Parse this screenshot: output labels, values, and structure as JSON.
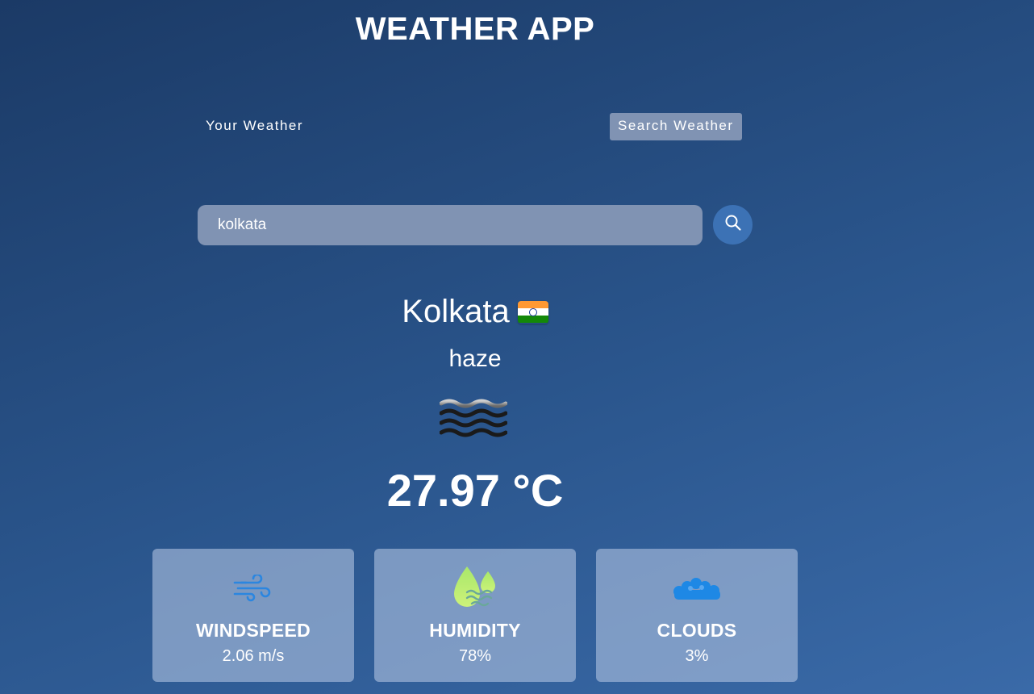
{
  "app": {
    "title": "WEATHER APP"
  },
  "tabs": {
    "your_weather": "Your Weather",
    "search_weather": "Search Weather",
    "active": "search_weather"
  },
  "search": {
    "value": "kolkata",
    "button_icon": "search-icon"
  },
  "weather": {
    "city": "Kolkata",
    "country_flag": "india-flag-icon",
    "condition": "haze",
    "condition_icon": "haze-icon",
    "temperature": "27.97 °C"
  },
  "metrics": [
    {
      "label": "WINDSPEED",
      "value": "2.06 m/s",
      "icon": "wind-icon"
    },
    {
      "label": "HUMIDITY",
      "value": "78%",
      "icon": "humidity-icon"
    },
    {
      "label": "CLOUDS",
      "value": "3%",
      "icon": "clouds-icon"
    }
  ],
  "colors": {
    "background_start": "#1b3a66",
    "background_end": "#3a6aa8",
    "active_tab": "#8093b3",
    "search_button": "#3c72b5",
    "card": "#acc0de",
    "flag_saffron": "#ff9933",
    "flag_green": "#138808"
  }
}
